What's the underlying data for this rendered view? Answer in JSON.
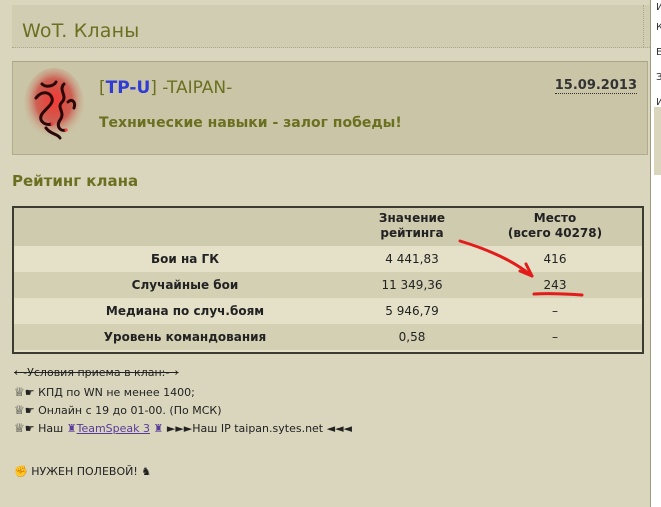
{
  "page": {
    "section_title": "WoT. Кланы"
  },
  "clan": {
    "bracket_open": "[",
    "tag": "TP-U",
    "bracket_close": "]",
    "name": " -TAIPAN-",
    "motto": "Технические навыки - залог победы!",
    "date": "15.09.2013",
    "logo_icon": "razer-snake-logo-icon"
  },
  "rating": {
    "title": "Рейтинг клана",
    "headers": {
      "value_line1": "Значение",
      "value_line2": "рейтинга",
      "place_line1": "Место",
      "place_line2": "(всего 40278)"
    },
    "rows": [
      {
        "label": "Бои на ГК",
        "value": "4 441,83",
        "place": "416"
      },
      {
        "label": "Случайные бои",
        "value": "11 349,36",
        "place": "243"
      },
      {
        "label": "Медиана по случ.боям",
        "value": "5 946,79",
        "place": "–"
      },
      {
        "label": "Уровень командования",
        "value": "0,58",
        "place": "–"
      }
    ]
  },
  "info": {
    "conditions_title": "←-Условия приема в клан:-→",
    "line1": "КПД по WN не менее 1400;",
    "line2": "Онлайн с 19 до 01-00. (По МСК)",
    "line3_prefix": "Наш",
    "teamspeak": "TeamSpeak 3",
    "line3_suffix": "►►►Наш IP taipan.sytes.net ◄◄◄",
    "wanted": "НУЖЕН ПОЛЕВОЙ!"
  },
  "colors": {
    "accent_red": "#e41b1b",
    "title_olive": "#6b7021",
    "tag_blue": "#2e3bd6"
  }
}
